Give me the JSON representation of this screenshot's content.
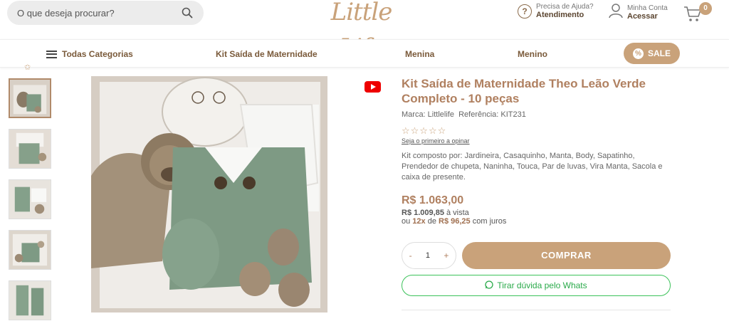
{
  "header": {
    "search_placeholder": "O que deseja procurar?",
    "logo": "Little Life",
    "help_small": "Precisa de Ajuda?",
    "help_strong": "Atendimento",
    "account_small": "Minha Conta",
    "account_strong": "Acessar",
    "cart_count": "0"
  },
  "nav": {
    "all_categories": "Todas Categorias",
    "items": [
      "Kit Saída de Maternidade",
      "Menina",
      "Menino"
    ],
    "sale": "SALE"
  },
  "product": {
    "title": "Kit Saída de Maternidade Theo Leão Verde Completo - 10 peças",
    "brand_label": "Marca: Littlelife",
    "ref_label": "Referência: KIT231",
    "stars": "☆☆☆☆☆",
    "review_link": "Seja o primeiro a opinar",
    "description": "Kit composto por: Jardineira, Casaquinho, Manta, Body, Sapatinho, Prendedor de chupeta, Naninha, Touca, Par de luvas, Vira Manta, Sacola e caixa de presente.",
    "price": "R$ 1.063,00",
    "pix_price": "R$ 1.009,85",
    "pix_suffix": " à vista",
    "inst_prefix": "ou ",
    "inst_count": "12x",
    "inst_middle": " de ",
    "inst_value": "R$ 96,25",
    "inst_suffix": " com juros",
    "quantity": "1",
    "minus": "-",
    "plus": "+",
    "buy_label": "COMPRAR",
    "whats_label": "Tirar dúvida pelo Whats"
  },
  "colors": {
    "brand": "#c9a27a",
    "title": "#b08060",
    "whatsapp": "#3cc25a"
  }
}
